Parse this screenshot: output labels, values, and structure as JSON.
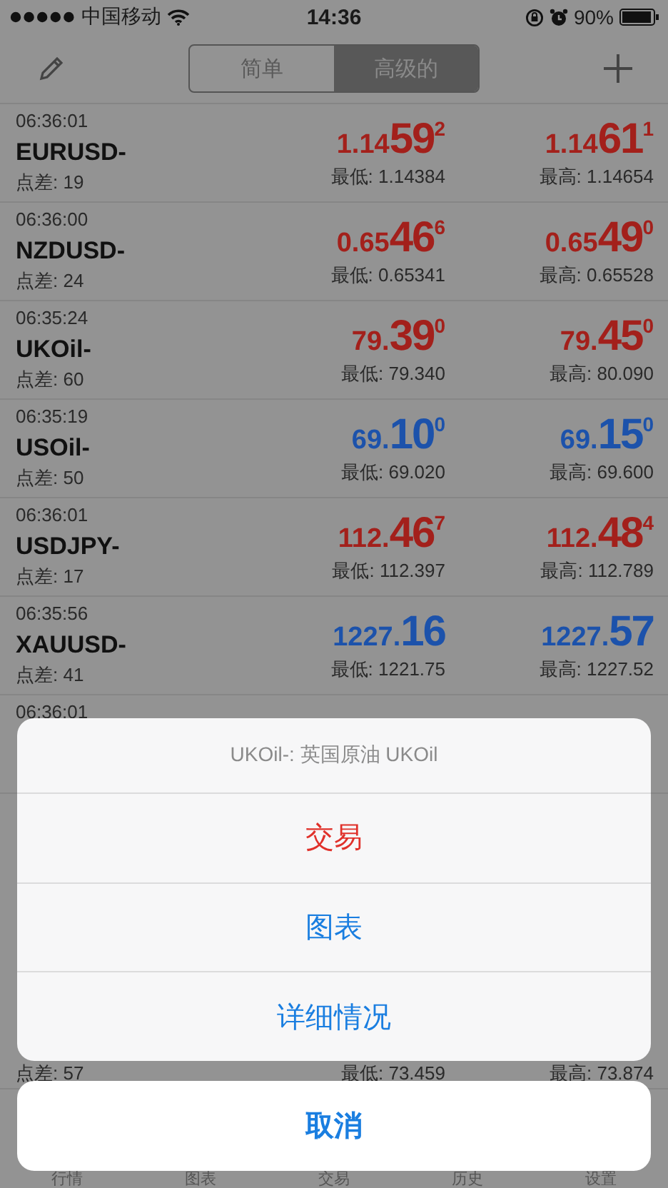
{
  "status_bar": {
    "carrier": "中国移动",
    "time": "14:36",
    "battery": "90%"
  },
  "segments": [
    {
      "label": "简单",
      "selected": false
    },
    {
      "label": "高级的",
      "selected": true
    }
  ],
  "quotes": [
    {
      "time": "06:36:01",
      "symbol": "EURUSD-",
      "spread": "点差: 19",
      "color": "#a3201b",
      "bid": {
        "small": "1.14",
        "big": "59",
        "sup": "2"
      },
      "ask": {
        "small": "1.14",
        "big": "61",
        "sup": "1"
      },
      "low": "最低: 1.14384",
      "high": "最高: 1.14654"
    },
    {
      "time": "06:36:00",
      "symbol": "NZDUSD-",
      "spread": "点差: 24",
      "color": "#a3201b",
      "bid": {
        "small": "0.65",
        "big": "46",
        "sup": "6"
      },
      "ask": {
        "small": "0.65",
        "big": "49",
        "sup": "0"
      },
      "low": "最低: 0.65341",
      "high": "最高: 0.65528"
    },
    {
      "time": "06:35:24",
      "symbol": "UKOil-",
      "spread": "点差: 60",
      "color": "#a3201b",
      "bid": {
        "small": "79.",
        "big": "39",
        "sup": "0"
      },
      "ask": {
        "small": "79.",
        "big": "45",
        "sup": "0"
      },
      "low": "最低: 79.340",
      "high": "最高: 80.090"
    },
    {
      "time": "06:35:19",
      "symbol": "USOil-",
      "spread": "点差: 50",
      "color": "#1c52ab",
      "bid": {
        "small": "69.",
        "big": "10",
        "sup": "0"
      },
      "ask": {
        "small": "69.",
        "big": "15",
        "sup": "0"
      },
      "low": "最低: 69.020",
      "high": "最高: 69.600"
    },
    {
      "time": "06:36:01",
      "symbol": "USDJPY-",
      "spread": "点差: 17",
      "color": "#a3201b",
      "bid": {
        "small": "112.",
        "big": "46",
        "sup": "7"
      },
      "ask": {
        "small": "112.",
        "big": "48",
        "sup": "4"
      },
      "low": "最低: 112.397",
      "high": "最高: 112.789"
    },
    {
      "time": "06:35:56",
      "symbol": "XAUUSD-",
      "spread": "点差: 41",
      "color": "#1c52ab",
      "bid": {
        "small": "1227.",
        "big": "16"
      },
      "ask": {
        "small": "1227.",
        "big": "57"
      },
      "low": "最低: 1221.75",
      "high": "最高: 1227.52"
    },
    {
      "time": "06:36:01"
    }
  ],
  "bottom_quote": {
    "spread": "点差: 57",
    "low": "最低: 73.459",
    "high": "最高: 73.874"
  },
  "tab_bar": [
    "行情",
    "图表",
    "交易",
    "历史",
    "设置"
  ],
  "action_sheet": {
    "title": "UKOil-: 英国原油 UKOil",
    "actions": [
      {
        "label": "交易",
        "kind": "destructive"
      },
      {
        "label": "图表",
        "kind": "default"
      },
      {
        "label": "详细情况",
        "kind": "default"
      }
    ],
    "cancel": "取消"
  }
}
